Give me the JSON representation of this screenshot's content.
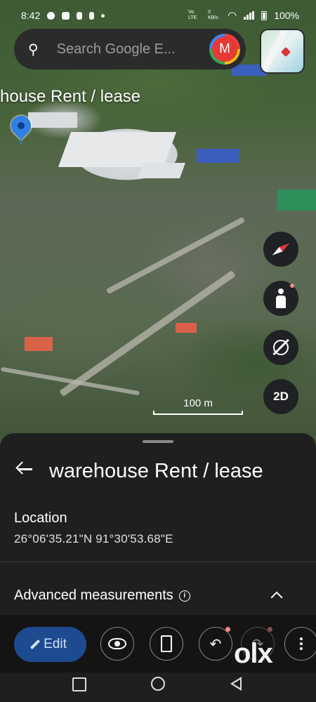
{
  "status_bar": {
    "time": "8:42",
    "network_label": "Vo LTE",
    "data_rate": "0 KB/s",
    "battery": "100%"
  },
  "search": {
    "placeholder": "Search Google E...",
    "avatar_letter": "M"
  },
  "map": {
    "pin_label": "house Rent / lease",
    "scale_label": "100 m",
    "view_mode_label": "2D"
  },
  "sheet": {
    "title": "warehouse Rent / lease",
    "location_label": "Location",
    "location_value": "26°06'35.21\"N 91°30'53.68\"E",
    "advanced_label": "Advanced measurements"
  },
  "toolbar": {
    "edit_label": "Edit"
  },
  "watermark": {
    "text": "olx"
  },
  "colors": {
    "sheet_bg": "#1f1f1f",
    "edit_button_bg": "#1e4a8f",
    "pin_blue": "#2f7fe6",
    "avatar_red": "#e53935"
  }
}
